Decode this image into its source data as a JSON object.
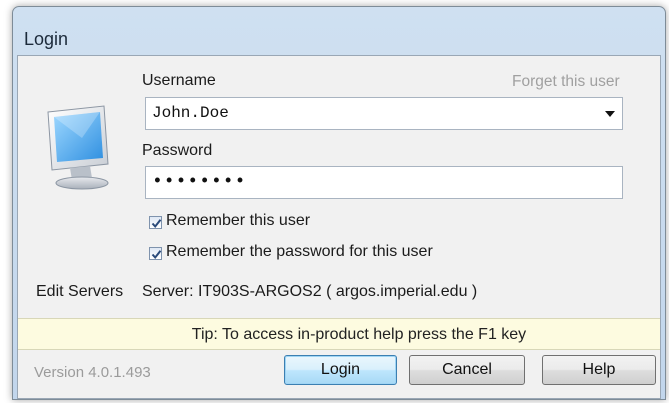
{
  "window": {
    "title": "Login"
  },
  "form": {
    "username_label": "Username",
    "forget_link": "Forget this user",
    "username_value": "John.Doe",
    "password_label": "Password",
    "password_value": "••••••••",
    "remember_user_label": "Remember this user",
    "remember_user_checked": true,
    "remember_password_label": "Remember the password for this user",
    "remember_password_checked": true
  },
  "server": {
    "edit_servers_label": "Edit Servers",
    "server_text": "Server: IT903S-ARGOS2 ( argos.imperial.edu )"
  },
  "tip": "Tip: To access in-product help press the F1 key",
  "footer": {
    "version": "Version 4.0.1.493",
    "login_button": "Login",
    "cancel_button": "Cancel",
    "help_button": "Help"
  },
  "icons": {
    "app": "computer-monitor-icon",
    "dropdown": "chevron-down-icon",
    "check": "checkmark-icon"
  }
}
